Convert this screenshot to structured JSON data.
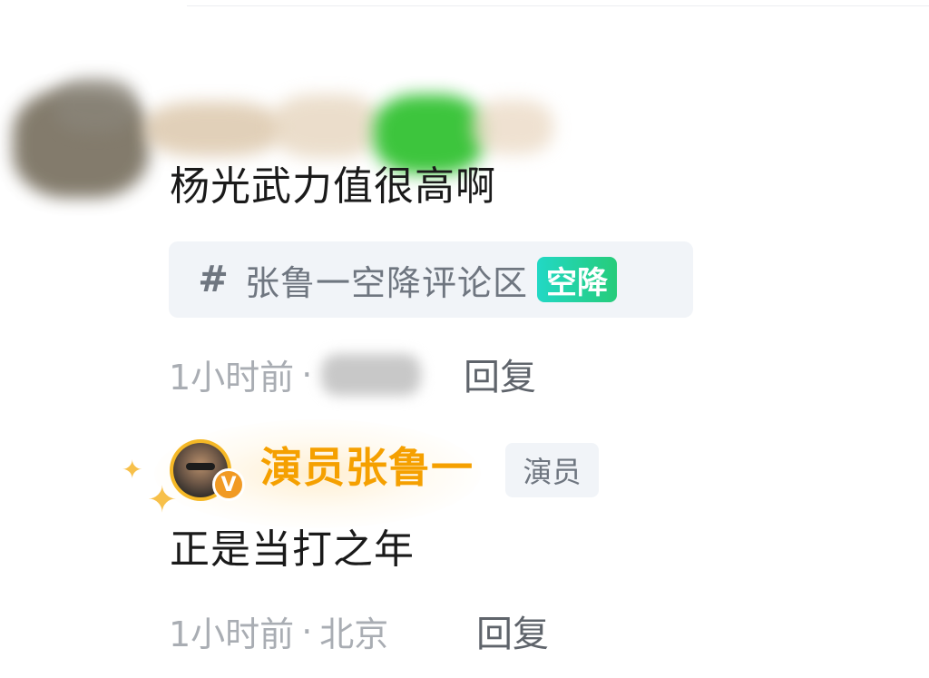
{
  "comment": {
    "text": "杨光武力值很高啊",
    "topic": {
      "icon": "hash-icon",
      "hash": "#",
      "label": "张鲁一空降评论区",
      "badge": "空降"
    },
    "meta": {
      "time": "1小时前",
      "separator": "·"
    },
    "reply_label": "回复"
  },
  "reply": {
    "username": "演员张鲁一",
    "verified_mark": "V",
    "tag": "演员",
    "text": "正是当打之年",
    "meta": {
      "time": "1小时前",
      "separator": "·",
      "location": "北京"
    },
    "reply_label": "回复"
  },
  "colors": {
    "username": "#f5a000",
    "badge_gradient_start": "#22d8c5",
    "badge_gradient_end": "#26cc7a",
    "verified": "#f19a24",
    "meta_text": "#a9adb3"
  }
}
